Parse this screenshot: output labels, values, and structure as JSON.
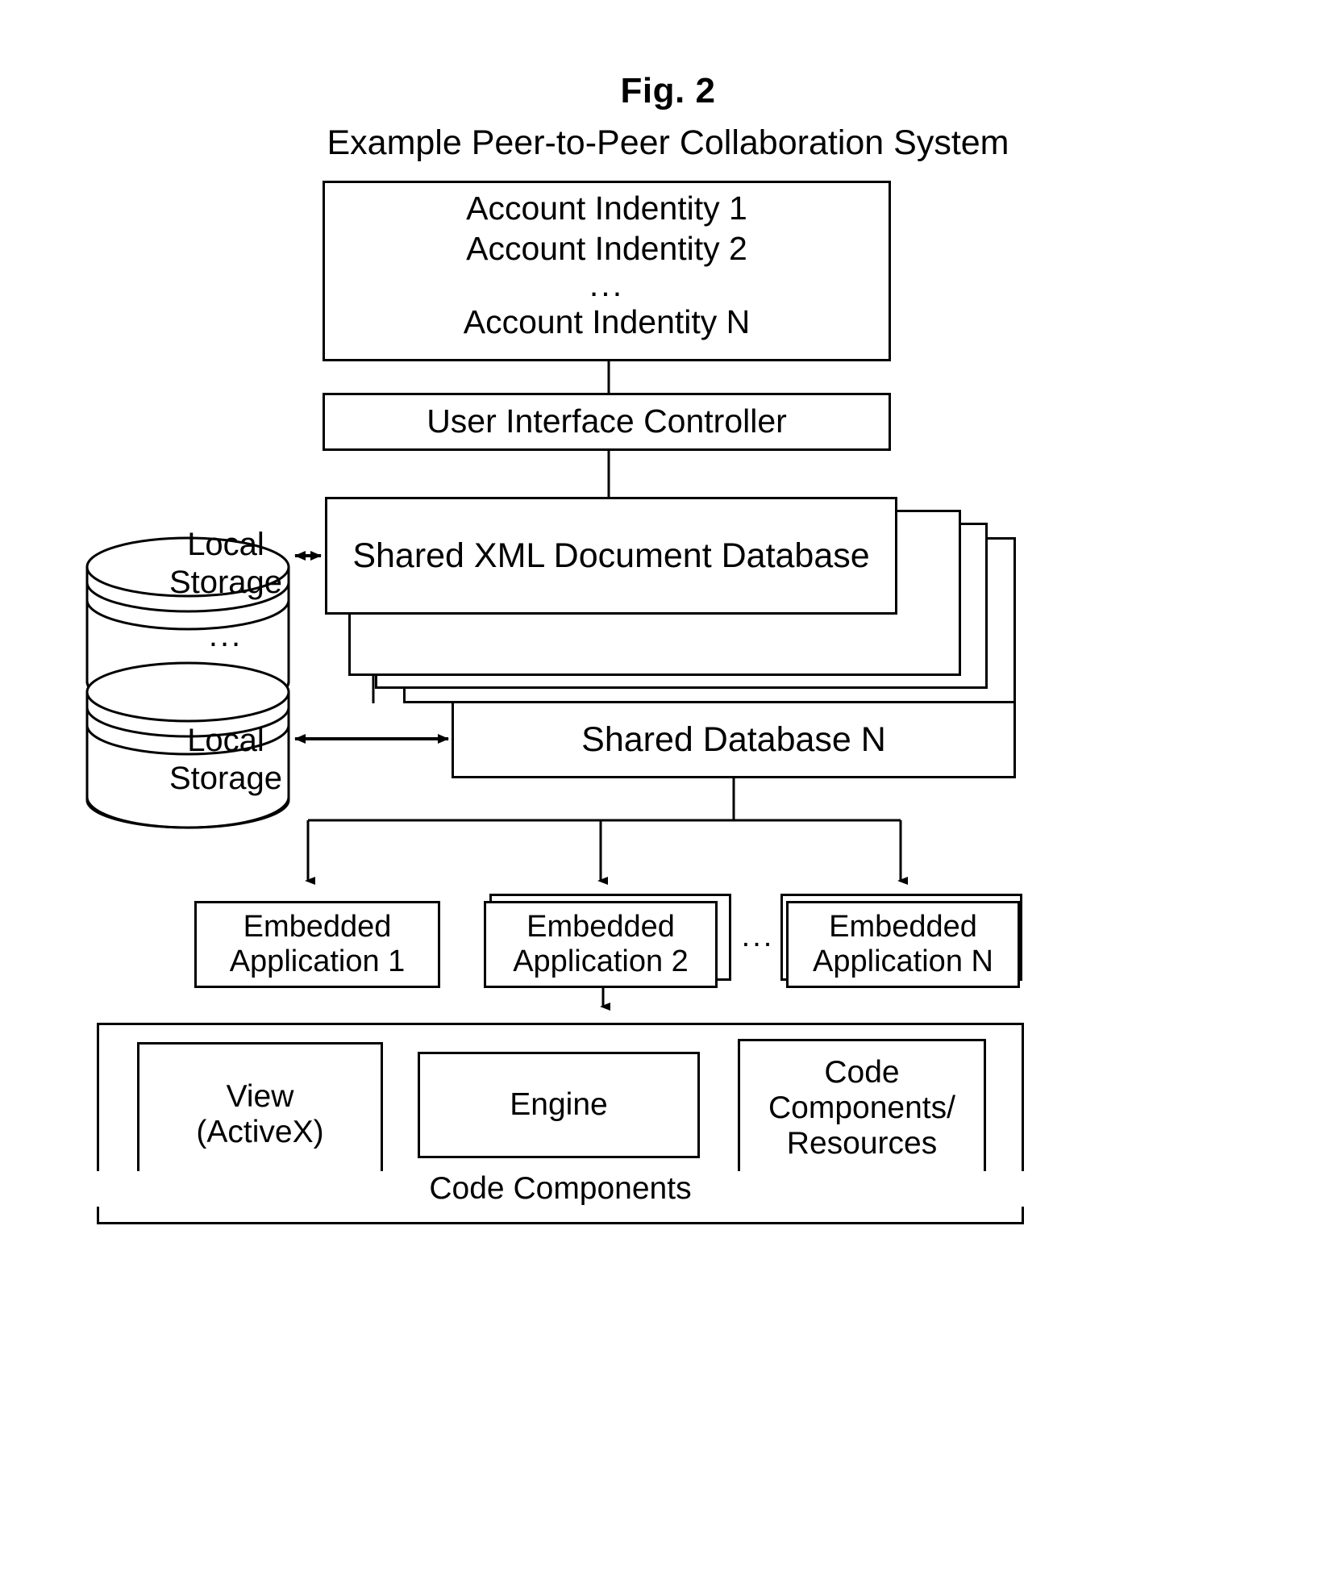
{
  "figure": {
    "label": "Fig. 2",
    "title": "Example Peer-to-Peer Collaboration System"
  },
  "nodes": {
    "account_identity": {
      "line1": "Account Indentity 1",
      "line2": "Account Indentity 2",
      "ellipsis": "...",
      "line4": "Account Indentity N"
    },
    "ui_controller": {
      "label": "User Interface Controller"
    },
    "shared_xml_db": {
      "label": "Shared XML Document Database"
    },
    "shared_db_n": {
      "label": "Shared Database N"
    },
    "local_storage_1": {
      "line1": "Local",
      "line2": "Storage"
    },
    "local_storage_ellipsis": "...",
    "local_storage_2": {
      "line1": "Local",
      "line2": "Storage"
    },
    "embedded_app_1": {
      "line1": "Embedded",
      "line2": "Application 1"
    },
    "embedded_app_2": {
      "line1": "Embedded",
      "line2": "Application 2"
    },
    "embedded_apps_ellipsis": "...",
    "embedded_app_n": {
      "line1": "Embedded",
      "line2": "Application N"
    },
    "code_components_panel": {
      "label": "Code Components"
    },
    "view": {
      "line1": "View",
      "line2": "(ActiveX)"
    },
    "engine": {
      "label": "Engine"
    },
    "code_resources": {
      "line1": "Code",
      "line2": "Components/",
      "line3": "Resources"
    }
  },
  "style": {
    "stroke": "#000000",
    "background": "#ffffff"
  }
}
